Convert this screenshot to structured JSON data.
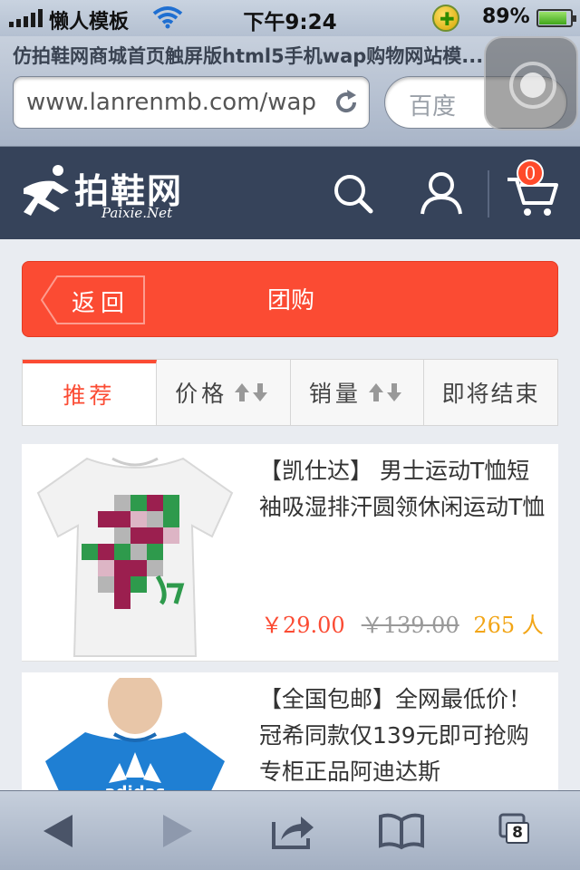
{
  "status_bar": {
    "carrier": "懒人模板",
    "time": "下午9:24",
    "battery_pct": "89%",
    "battery_level": 0.89
  },
  "browser": {
    "page_title": "仿拍鞋网商城首页触屏版html5手机wap购物网站模...",
    "url": "www.lanrenmb.com/wap",
    "search_placeholder": "百度",
    "tab_count": "8"
  },
  "header": {
    "logo_cn": "拍鞋网",
    "logo_en": "Paixie.Net",
    "cart_count": "0"
  },
  "titlebar": {
    "back_label": "返回",
    "title": "团购"
  },
  "tabs": [
    {
      "label": "推荐",
      "active": true
    },
    {
      "label": "价格",
      "sortable": true
    },
    {
      "label": "销量",
      "sortable": true
    },
    {
      "label": "即将结束"
    }
  ],
  "products": [
    {
      "name": "【凯仕达】 男士运动T恤短袖吸湿排汗圆领休闲运动T恤",
      "price": "￥29.00",
      "old_price": "￥139.00",
      "sold": "265 人"
    },
    {
      "name": "【全国包邮】全网最低价！冠希同款仅139元即可抢购专柜正品阿迪达斯",
      "price": "",
      "old_price": "",
      "sold": ""
    }
  ],
  "colors": {
    "accent": "#fb4b33",
    "header_bg": "#36435a",
    "sold_color": "#f2a516"
  }
}
